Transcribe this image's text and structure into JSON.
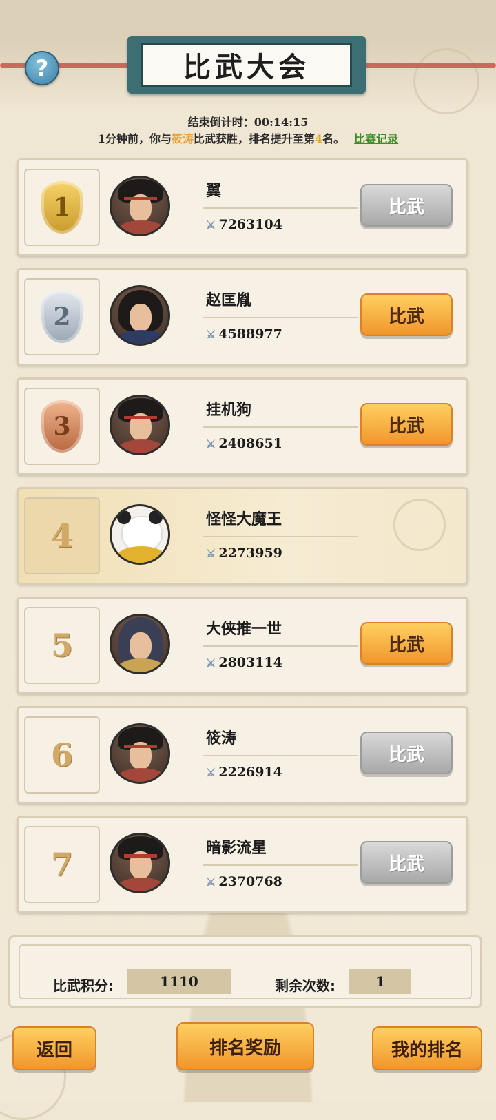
{
  "header": {
    "title": "比武大会",
    "help_icon": "?",
    "countdown_label": "结束倒计时：",
    "countdown_value": "00:14:15",
    "notice_prefix": "1分钟前，你与",
    "notice_opponent": "筱涛",
    "notice_mid": "比武获胜，排名提升至第",
    "notice_rank": "4",
    "notice_suffix": "名。",
    "record_link": "比赛记录"
  },
  "rows": [
    {
      "rank": "1",
      "name": "翼",
      "power": "7263104",
      "button": "比武",
      "button_enabled": false
    },
    {
      "rank": "2",
      "name": "赵匡胤",
      "power": "4588977",
      "button": "比武",
      "button_enabled": true
    },
    {
      "rank": "3",
      "name": "挂机狗",
      "power": "2408651",
      "button": "比武",
      "button_enabled": true
    },
    {
      "rank": "4",
      "name": "怪怪大魔王",
      "power": "2273959",
      "button": "",
      "button_enabled": false
    },
    {
      "rank": "5",
      "name": "大侠推一世",
      "power": "2803114",
      "button": "比武",
      "button_enabled": true
    },
    {
      "rank": "6",
      "name": "筱涛",
      "power": "2226914",
      "button": "比武",
      "button_enabled": false
    },
    {
      "rank": "7",
      "name": "暗影流星",
      "power": "2370768",
      "button": "比武",
      "button_enabled": false
    }
  ],
  "stats": {
    "score_label": "比武积分:",
    "score_value": "1110",
    "remaining_label": "剩余次数:",
    "remaining_value": "1"
  },
  "footer": {
    "back": "返回",
    "rewards": "排名奖励",
    "my_rank": "我的排名"
  },
  "colors": {
    "accent_orange": "#f0962b",
    "disabled_gray": "#a8a8a8",
    "highlight": "#e7a13a",
    "link_green": "#3f8b2a"
  }
}
